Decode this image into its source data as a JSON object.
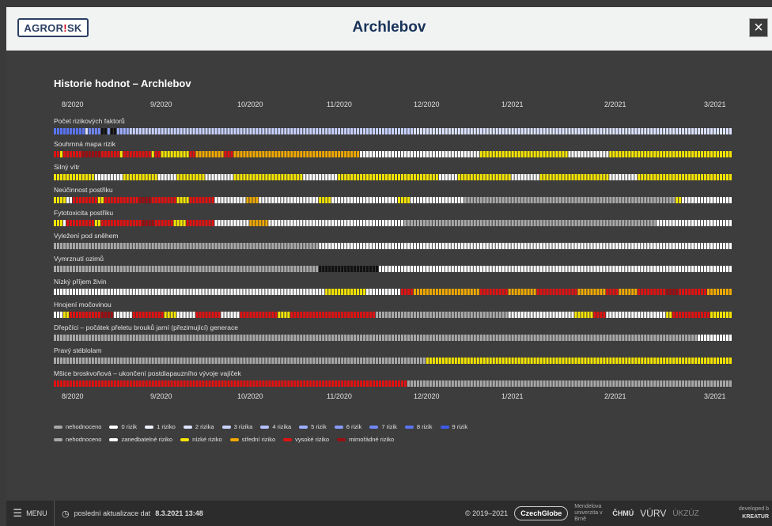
{
  "header": {
    "logo_a": "AGRO",
    "logo_b": "R",
    "logo_c": "!",
    "logo_d": "SK",
    "title": "Archlebov",
    "close": "×"
  },
  "chart_heading": "Historie hodnot – Archlebov",
  "axis_labels": [
    "8/2020",
    "9/2020",
    "10/2020",
    "11/2020",
    "12/2020",
    "1/2021",
    "2/2021",
    "3/2021"
  ],
  "colors": {
    "nehodnoceno": "#a8a8a8",
    "white": "#ffffff",
    "black": "#111111",
    "low": "#f5e400",
    "mid": "#f0a800",
    "high": "#e01212",
    "extreme": "#9b0e12",
    "cnt0": "#ffffff",
    "cnt1": "#eef2ff",
    "cnt2": "#dde4ff",
    "cnt3": "#c8d2ff",
    "cnt4": "#b2c1ff",
    "cnt5": "#9caeff",
    "cnt6": "#869bfb",
    "cnt7": "#6f87f7",
    "cnt8": "#5a74f2",
    "cnt9": "#3d5ae8"
  },
  "rows": [
    {
      "label": "Počet rizikových faktorů",
      "segments": [
        [
          0.045,
          "cnt8"
        ],
        [
          0.005,
          "cnt2"
        ],
        [
          0.02,
          "cnt7"
        ],
        [
          0.008,
          "black"
        ],
        [
          0.004,
          "cnt6"
        ],
        [
          0.008,
          "black"
        ],
        [
          0.02,
          "cnt5"
        ],
        [
          0.42,
          "cnt3"
        ],
        [
          0.47,
          "cnt2"
        ]
      ]
    },
    {
      "label": "Souhrnná mapa rizik",
      "segments": [
        [
          0.01,
          "high"
        ],
        [
          0.005,
          "low"
        ],
        [
          0.03,
          "high"
        ],
        [
          0.03,
          "extreme"
        ],
        [
          0.03,
          "high"
        ],
        [
          0.005,
          "low"
        ],
        [
          0.04,
          "high"
        ],
        [
          0.005,
          "low"
        ],
        [
          0.01,
          "high"
        ],
        [
          0.04,
          "low"
        ],
        [
          0.01,
          "high"
        ],
        [
          0.04,
          "mid"
        ],
        [
          0.015,
          "high"
        ],
        [
          0.19,
          "mid"
        ],
        [
          0.18,
          "white"
        ],
        [
          0.13,
          "low"
        ],
        [
          0.06,
          "white"
        ],
        [
          0.18,
          "low"
        ]
      ]
    },
    {
      "label": "Silný vítr",
      "segments": [
        [
          0.06,
          "low"
        ],
        [
          0.04,
          "white"
        ],
        [
          0.05,
          "low"
        ],
        [
          0.03,
          "white"
        ],
        [
          0.04,
          "low"
        ],
        [
          0.04,
          "white"
        ],
        [
          0.1,
          "low"
        ],
        [
          0.05,
          "white"
        ],
        [
          0.15,
          "low"
        ],
        [
          0.03,
          "white"
        ],
        [
          0.08,
          "low"
        ],
        [
          0.04,
          "white"
        ],
        [
          0.1,
          "low"
        ],
        [
          0.04,
          "white"
        ],
        [
          0.15,
          "low"
        ]
      ]
    },
    {
      "label": "Neúčinnost postřiku",
      "segments": [
        [
          0.02,
          "low"
        ],
        [
          0.01,
          "white"
        ],
        [
          0.04,
          "high"
        ],
        [
          0.01,
          "low"
        ],
        [
          0.05,
          "high"
        ],
        [
          0.02,
          "extreme"
        ],
        [
          0.04,
          "high"
        ],
        [
          0.02,
          "low"
        ],
        [
          0.04,
          "high"
        ],
        [
          0.01,
          "white"
        ],
        [
          0.04,
          "white"
        ],
        [
          0.02,
          "mid"
        ],
        [
          0.09,
          "white"
        ],
        [
          0.02,
          "low"
        ],
        [
          0.1,
          "white"
        ],
        [
          0.02,
          "low"
        ],
        [
          0.08,
          "white"
        ],
        [
          0.32,
          "nehodnoceno"
        ],
        [
          0.01,
          "low"
        ],
        [
          0.06,
          "white"
        ]
      ]
    },
    {
      "label": "Fytotoxicita postřiku",
      "segments": [
        [
          0.015,
          "low"
        ],
        [
          0.005,
          "white"
        ],
        [
          0.04,
          "high"
        ],
        [
          0.01,
          "low"
        ],
        [
          0.06,
          "high"
        ],
        [
          0.02,
          "extreme"
        ],
        [
          0.03,
          "high"
        ],
        [
          0.02,
          "low"
        ],
        [
          0.04,
          "high"
        ],
        [
          0.05,
          "white"
        ],
        [
          0.03,
          "mid"
        ],
        [
          0.2,
          "white"
        ],
        [
          0.37,
          "nehodnoceno"
        ],
        [
          0.11,
          "white"
        ]
      ]
    },
    {
      "label": "Vyležení pod sněhem",
      "segments": [
        [
          0.39,
          "nehodnoceno"
        ],
        [
          0.61,
          "white"
        ]
      ]
    },
    {
      "label": "Vymrznutí ozimů",
      "segments": [
        [
          0.39,
          "nehodnoceno"
        ],
        [
          0.09,
          "black"
        ],
        [
          0.52,
          "white"
        ]
      ]
    },
    {
      "label": "Nízký příjem živin",
      "segments": [
        [
          0.4,
          "white"
        ],
        [
          0.06,
          "low"
        ],
        [
          0.05,
          "white"
        ],
        [
          0.02,
          "high"
        ],
        [
          0.1,
          "mid"
        ],
        [
          0.04,
          "high"
        ],
        [
          0.04,
          "mid"
        ],
        [
          0.06,
          "high"
        ],
        [
          0.04,
          "mid"
        ],
        [
          0.02,
          "high"
        ],
        [
          0.03,
          "mid"
        ],
        [
          0.04,
          "high"
        ],
        [
          0.02,
          "extreme"
        ],
        [
          0.04,
          "high"
        ],
        [
          0.04,
          "mid"
        ],
        [
          0.0,
          "white"
        ]
      ]
    },
    {
      "label": "Hnojení močovinou",
      "segments": [
        [
          0.015,
          "white"
        ],
        [
          0.01,
          "low"
        ],
        [
          0.05,
          "high"
        ],
        [
          0.02,
          "extreme"
        ],
        [
          0.03,
          "white"
        ],
        [
          0.05,
          "high"
        ],
        [
          0.02,
          "low"
        ],
        [
          0.03,
          "white"
        ],
        [
          0.04,
          "high"
        ],
        [
          0.03,
          "white"
        ],
        [
          0.06,
          "high"
        ],
        [
          0.02,
          "low"
        ],
        [
          0.13,
          "high"
        ],
        [
          0.2,
          "nehodnoceno"
        ],
        [
          0.1,
          "white"
        ],
        [
          0.03,
          "low"
        ],
        [
          0.02,
          "high"
        ],
        [
          0.09,
          "white"
        ],
        [
          0.01,
          "low"
        ],
        [
          0.06,
          "high"
        ],
        [
          0.02,
          "low"
        ]
      ]
    },
    {
      "label": "Dřepčíci – počátek přeletu brouků jarní (přezimující) generace",
      "segments": [
        [
          0.95,
          "nehodnoceno"
        ],
        [
          0.05,
          "white"
        ]
      ]
    },
    {
      "label": "Pravý stéblolam",
      "segments": [
        [
          0.55,
          "nehodnoceno"
        ],
        [
          0.45,
          "low"
        ]
      ]
    },
    {
      "label": "Mšice broskvoňová – ukončení postdiapauzního vývoje vajíček",
      "segments": [
        [
          0.52,
          "high"
        ],
        [
          0.48,
          "nehodnoceno"
        ]
      ]
    }
  ],
  "legend1": [
    {
      "label": "nehodnoceno",
      "color": "#a8a8a8"
    },
    {
      "label": "0 rizik",
      "color": "#ffffff"
    },
    {
      "label": "1 riziko",
      "color": "#eef2ff"
    },
    {
      "label": "2 rizika",
      "color": "#dde4ff"
    },
    {
      "label": "3 rizika",
      "color": "#c8d2ff"
    },
    {
      "label": "4 rizika",
      "color": "#b2c1ff"
    },
    {
      "label": "5 rizik",
      "color": "#9caeff"
    },
    {
      "label": "6 rizik",
      "color": "#869bfb"
    },
    {
      "label": "7 rizik",
      "color": "#6f87f7"
    },
    {
      "label": "8 rizik",
      "color": "#5a74f2"
    },
    {
      "label": "9 rizik",
      "color": "#3d5ae8"
    }
  ],
  "legend2": [
    {
      "label": "nehodnoceno",
      "color": "#a8a8a8"
    },
    {
      "label": "zanedbatelné riziko",
      "color": "#ffffff"
    },
    {
      "label": "nízké riziko",
      "color": "#f5e400"
    },
    {
      "label": "střední riziko",
      "color": "#f0a800"
    },
    {
      "label": "vysoké riziko",
      "color": "#e01212"
    },
    {
      "label": "mimořádné riziko",
      "color": "#9b0e12"
    }
  ],
  "footer": {
    "menu": "MENU",
    "update_text": "poslední aktualizace dat",
    "update_date": "8.3.2021 13:48",
    "copyright": "© 2019–2021",
    "partner1": "CzechGlobe",
    "partner2": "Mendelova univerzita v Brně",
    "partner3": "ČHMÚ",
    "partner4": "VÚRV",
    "partner5": "ÚKZÚZ",
    "dev1": "developed b",
    "dev2": "KREATUR"
  }
}
